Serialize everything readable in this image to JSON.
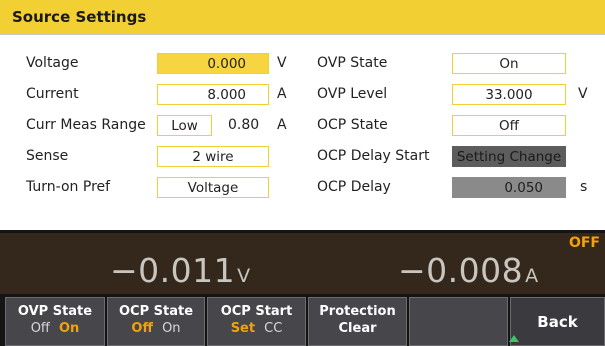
{
  "title": "Source Settings",
  "left": {
    "voltage": {
      "label": "Voltage",
      "value": "0.000",
      "unit": "V"
    },
    "current": {
      "label": "Current",
      "value": "8.000",
      "unit": "A"
    },
    "curr_meas_range": {
      "label": "Curr Meas Range",
      "option": "Low",
      "value": "0.80",
      "unit": "A"
    },
    "sense": {
      "label": "Sense",
      "value": "2 wire"
    },
    "turn_on_pref": {
      "label": "Turn-on Pref",
      "value": "Voltage"
    }
  },
  "right": {
    "ovp_state": {
      "label": "OVP State",
      "value": "On"
    },
    "ovp_level": {
      "label": "OVP Level",
      "value": "33.000",
      "unit": "V"
    },
    "ocp_state": {
      "label": "OCP State",
      "value": "Off"
    },
    "ocp_delay_start": {
      "label": "OCP Delay Start",
      "value": "Setting Change"
    },
    "ocp_delay": {
      "label": "OCP Delay",
      "value": "0.050",
      "unit": "s"
    }
  },
  "measurement": {
    "voltage": "−0.011",
    "voltage_unit": "V",
    "current": "−0.008",
    "current_unit": "A",
    "output_state": "OFF"
  },
  "softkeys": {
    "ovp_state": {
      "label": "OVP State",
      "opt1": "Off",
      "opt2": "On"
    },
    "ocp_state": {
      "label": "OCP State",
      "opt1": "Off",
      "opt2": "On"
    },
    "ocp_start": {
      "label": "OCP Start",
      "opt1": "Set",
      "opt2": "CC"
    },
    "protection": {
      "label": "Protection",
      "sub": "Clear"
    },
    "back": {
      "label": "Back"
    }
  },
  "colors": {
    "accent": "#f2cf33",
    "active": "#f2a20a",
    "meas_bg": "#33281b"
  }
}
